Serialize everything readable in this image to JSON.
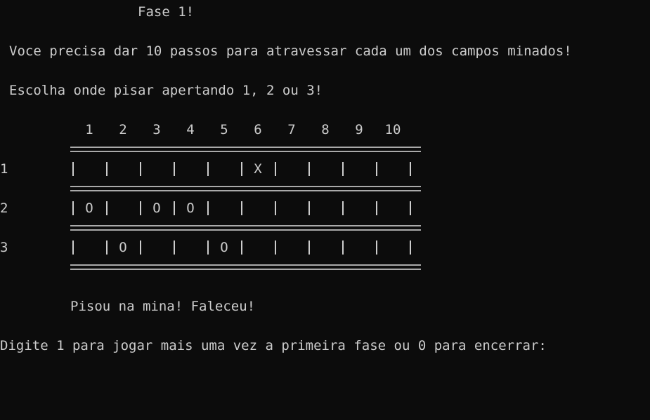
{
  "title": "Fase 1!",
  "instructions": [
    "Voce precisa dar 10 passos para atravessar cada um dos campos minados!",
    "Escolha onde pisar apertando 1, 2 ou 3!"
  ],
  "columns": [
    "1",
    "2",
    "3",
    "4",
    "5",
    "6",
    "7",
    "8",
    "9",
    "10"
  ],
  "rows": [
    {
      "label": "1",
      "cells": [
        "",
        "",
        "",
        "",
        "",
        "X",
        "",
        "",
        "",
        ""
      ]
    },
    {
      "label": "2",
      "cells": [
        "O",
        "",
        "O",
        "O",
        "",
        "",
        "",
        "",
        "",
        ""
      ]
    },
    {
      "label": "3",
      "cells": [
        "",
        "O",
        "",
        "",
        "O",
        "",
        "",
        "",
        "",
        ""
      ]
    }
  ],
  "result": "Pisou na mina! Faleceu!",
  "prompt": "Digite 1 para jogar mais uma vez a primeira fase ou 0 para encerrar:"
}
